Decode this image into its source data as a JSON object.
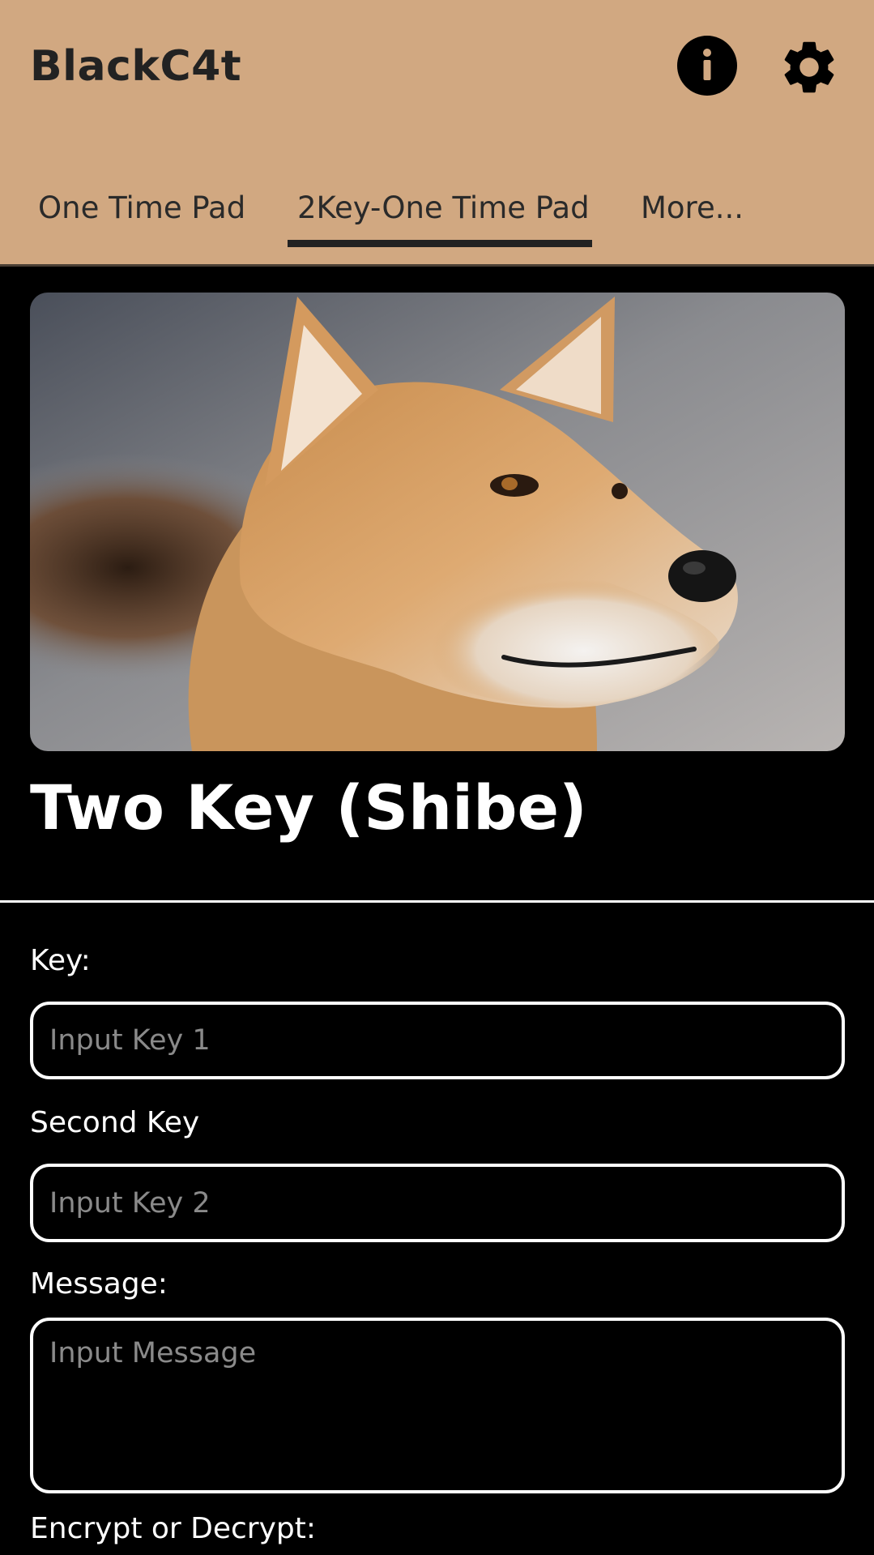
{
  "app": {
    "title": "BlackC4t"
  },
  "toolbar": {
    "info_icon": "info-circle-icon",
    "settings_icon": "gear-icon"
  },
  "tabs": [
    {
      "label": "One Time Pad",
      "selected": false
    },
    {
      "label": "2Key-One Time Pad",
      "selected": true
    },
    {
      "label": "More..."
    }
  ],
  "hero": {
    "subject": "shiba-inu-dog-photo"
  },
  "main": {
    "title": "Two Key (Shibe)",
    "key_label": "Key:",
    "key_placeholder": "Input Key 1",
    "second_key_label": "Second Key",
    "second_key_placeholder": "Input Key 2",
    "message_label": "Message:",
    "message_placeholder": "Input Message",
    "mode_label": "Encrypt or Decrypt:"
  },
  "colors": {
    "appbar": "#d1a881",
    "background": "#000000",
    "text_dark": "#222222",
    "text_light": "#ffffff",
    "placeholder": "#8a8a8a"
  }
}
